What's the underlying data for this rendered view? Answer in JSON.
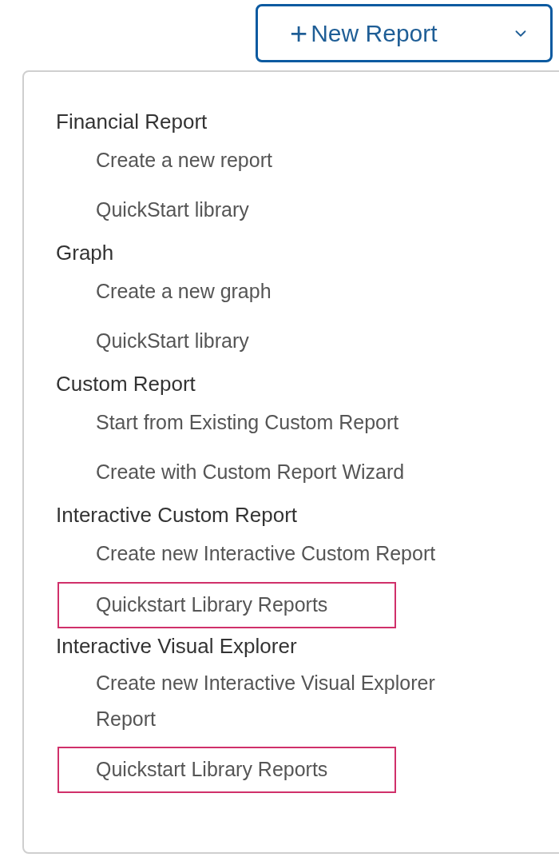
{
  "new_report_button": {
    "icon": "+",
    "label": "New Report"
  },
  "menu": {
    "groups": [
      {
        "heading": "Financial Report",
        "items": [
          {
            "label": "Create a new report",
            "highlighted": false
          },
          {
            "label": "QuickStart library",
            "highlighted": false
          }
        ]
      },
      {
        "heading": "Graph",
        "items": [
          {
            "label": "Create a new graph",
            "highlighted": false
          },
          {
            "label": "QuickStart library",
            "highlighted": false
          }
        ]
      },
      {
        "heading": "Custom Report",
        "items": [
          {
            "label": "Start from Existing Custom Report",
            "highlighted": false
          },
          {
            "label": "Create with Custom Report Wizard",
            "highlighted": false
          }
        ]
      },
      {
        "heading": "Interactive Custom Report",
        "items": [
          {
            "label": "Create new Interactive Custom Report",
            "highlighted": false
          },
          {
            "label": "Quickstart Library Reports",
            "highlighted": true
          }
        ]
      },
      {
        "heading": "Interactive Visual Explorer",
        "items": [
          {
            "label": "Create new Interactive Visual Explorer Report",
            "highlighted": false
          },
          {
            "label": "Quickstart Library Reports",
            "highlighted": true
          }
        ]
      }
    ]
  }
}
